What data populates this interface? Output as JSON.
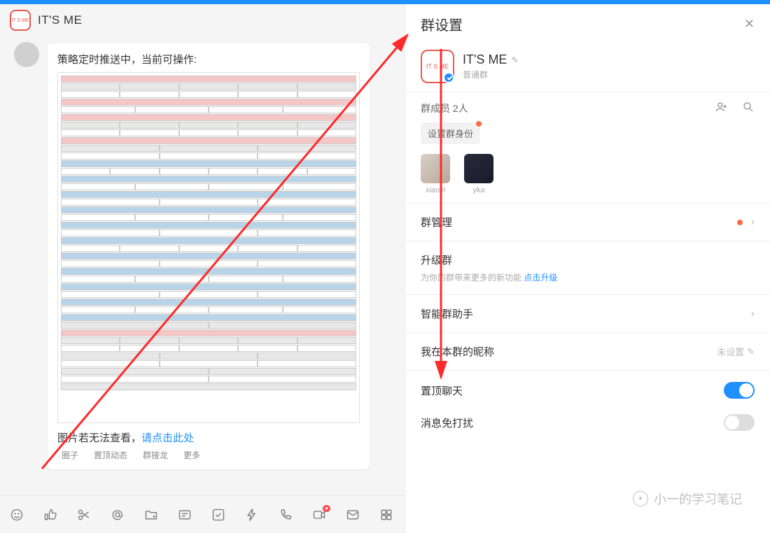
{
  "header": {
    "app_title": "IT'S ME",
    "avatar_text": "IT S ME"
  },
  "chat": {
    "message_text": "策略定时推送中，当前可操作:",
    "link_prefix": "图片若无法查看，",
    "link_text": "请点击此处",
    "tags": [
      "圈子",
      "置顶动态",
      "群接龙",
      "更多"
    ]
  },
  "toolbar": {
    "emoji": "emoji",
    "like": "like",
    "scissors": "scissors",
    "at": "at",
    "folder": "folder",
    "card": "card",
    "check": "check",
    "bolt": "bolt",
    "phone": "phone",
    "video": "video",
    "mail": "mail",
    "app": "app"
  },
  "settings": {
    "title": "群设置",
    "group_name": "IT'S ME",
    "group_sub": "普通群",
    "members_label": "群成员 2人",
    "identity_btn": "设置群身份",
    "members": [
      {
        "name": "xiaoyi"
      },
      {
        "name": "yka"
      }
    ],
    "manage": {
      "label": "群管理"
    },
    "upgrade": {
      "label": "升级群",
      "sub_prefix": "为你的群带来更多的新功能 ",
      "sub_link": "点击升级"
    },
    "assistant": {
      "label": "智能群助手"
    },
    "nickname": {
      "label": "我在本群的昵称",
      "value": "未设置"
    },
    "pin": {
      "label": "置顶聊天"
    },
    "mute": {
      "label": "消息免打扰"
    }
  },
  "watermark": {
    "text": "小一的学习笔记"
  }
}
